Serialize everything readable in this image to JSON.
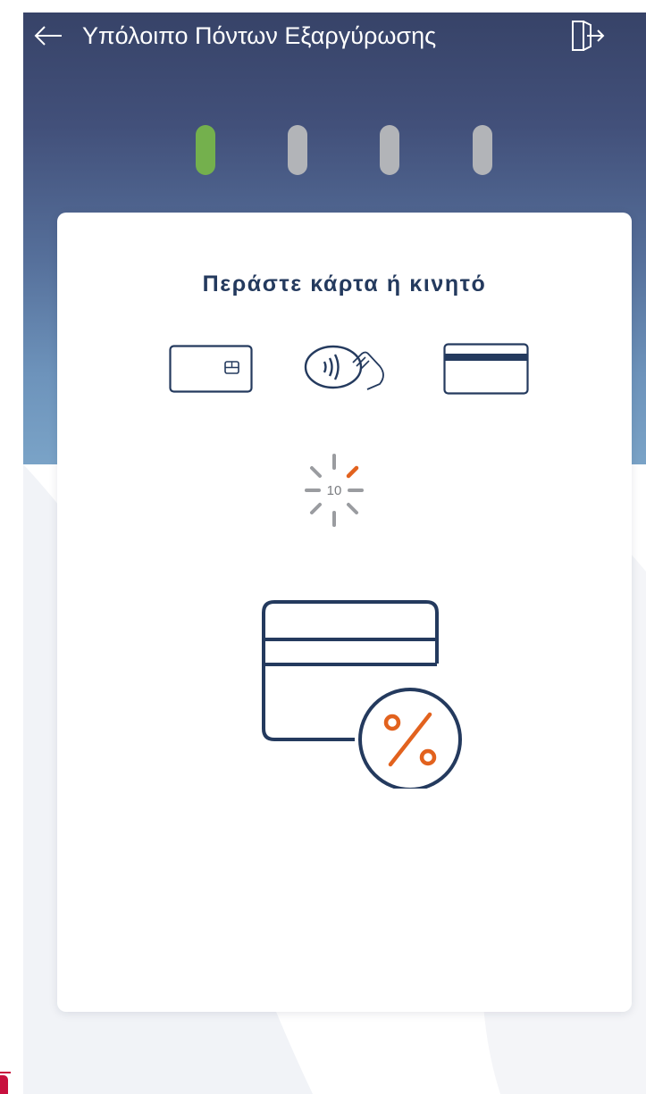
{
  "header": {
    "title": "Υπόλοιπο Πόντων Εξαργύρωσης",
    "back_icon": "arrow-left-icon",
    "exit_icon": "logout-door-icon"
  },
  "progress": {
    "total_steps": 4,
    "current_step": 1
  },
  "card": {
    "prompt": "Περάστε κάρτα ή κινητό",
    "payment_methods": [
      "chip-card-icon",
      "contactless-icon",
      "magstripe-card-icon"
    ],
    "countdown": "10",
    "illustration": "loyalty-card-percent-icon"
  },
  "colors": {
    "header_dark": "#374368",
    "header_light": "#7aa3c7",
    "step_active": "#74b04d",
    "step_inactive": "#b2b4b8",
    "navy": "#243a5e",
    "orange": "#e2621e",
    "accent_red": "#c8103e"
  }
}
